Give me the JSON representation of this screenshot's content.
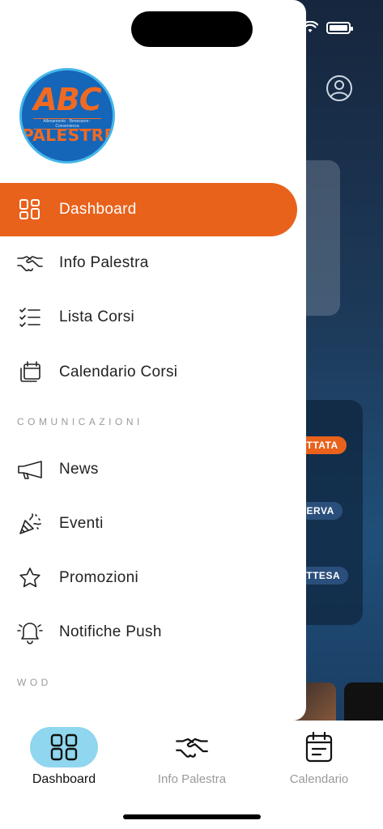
{
  "colors": {
    "accent": "#e8621c",
    "nav_active": "#8fd6ee",
    "bg_dark": "#16263d"
  },
  "logo": {
    "top_text": "ABC",
    "tagline": "Allenamento · Benessere · Convenienza",
    "bottom_text": "PALESTRE"
  },
  "background": {
    "tags": [
      "ETTATA",
      "SERVA",
      "ATTESA"
    ]
  },
  "menu": {
    "items": [
      {
        "label": "Dashboard",
        "icon": "dashboard-icon",
        "active": true
      },
      {
        "label": "Info Palestra",
        "icon": "handshake-icon"
      },
      {
        "label": "Lista Corsi",
        "icon": "checklist-icon"
      },
      {
        "label": "Calendario Corsi",
        "icon": "calendar-stack-icon"
      }
    ],
    "section_comunicazioni": "COMUNICAZIONI",
    "comunicazioni": [
      {
        "label": "News",
        "icon": "megaphone-icon"
      },
      {
        "label": "Eventi",
        "icon": "party-popper-icon"
      },
      {
        "label": "Promozioni",
        "icon": "star-icon"
      },
      {
        "label": "Notifiche Push",
        "icon": "bell-icon"
      }
    ],
    "section_wod": "WOD"
  },
  "bottom_nav": {
    "items": [
      {
        "label": "Dashboard",
        "icon": "dashboard-icon",
        "active": true
      },
      {
        "label": "Info Palestra",
        "icon": "handshake-icon"
      },
      {
        "label": "Calendario",
        "icon": "calendar-icon"
      }
    ]
  }
}
